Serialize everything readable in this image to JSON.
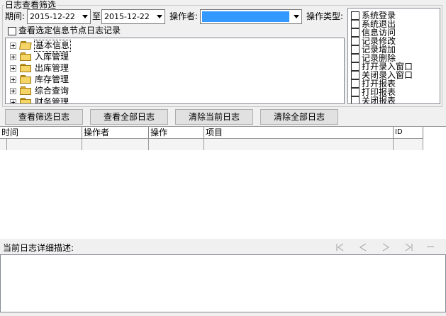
{
  "filter": {
    "title": "日志查看筛选",
    "period_label": "期间:",
    "date_from": "2015-12-22",
    "to_label": "至",
    "date_to": "2015-12-22",
    "operator_label": "操作者:",
    "operator_value": "",
    "optype_label": "操作类型:",
    "node_checkbox_label": "查看选定信息节点日志记录"
  },
  "tree": {
    "items": [
      {
        "label": "基本信息"
      },
      {
        "label": "入库管理"
      },
      {
        "label": "出库管理"
      },
      {
        "label": "库存管理"
      },
      {
        "label": "综合查询"
      },
      {
        "label": "财务管理"
      }
    ]
  },
  "op_types": [
    "系统登录",
    "系统退出",
    "信息访问",
    "记录修改",
    "记录增加",
    "记录删除",
    "打开录入窗口",
    "关闭录入窗口",
    "打开报表",
    "打印报表",
    "关闭报表"
  ],
  "buttons": {
    "view_filtered": "查看筛选日志",
    "view_all": "查看全部日志",
    "clear_current": "清除当前日志",
    "clear_all": "清除全部日志"
  },
  "grid": {
    "columns": [
      "时间",
      "操作者",
      "操作",
      "项目",
      "ID"
    ]
  },
  "detail": {
    "label": "当前日志详细描述:"
  },
  "colors": {
    "selection_blue": "#3399ff",
    "window_bg": "#f0f0f0",
    "folder_yellow": "#f5d565"
  },
  "icons": {
    "nav_first": "first-record-icon",
    "nav_prev": "prev-record-icon",
    "nav_next": "next-record-icon",
    "nav_last": "last-record-icon",
    "nav_extra": "collapse-icon"
  }
}
